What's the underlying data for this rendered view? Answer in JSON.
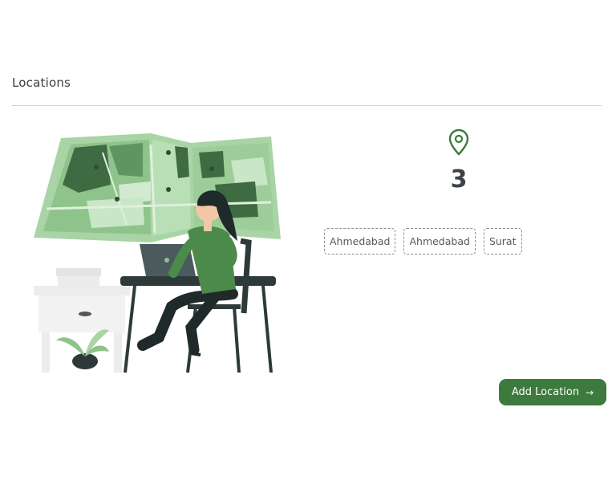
{
  "page": {
    "title": "Locations"
  },
  "stats": {
    "count": "3",
    "icon": "map-pin-icon",
    "accent": "#3c7a3d"
  },
  "locations": [
    "Ahmedabad",
    "Ahmedabad",
    "Surat"
  ],
  "actions": {
    "add_label": "Add Location",
    "add_icon": "→"
  },
  "colors": {
    "primary": "#3c7a3d",
    "text": "#3b3f44",
    "divider": "#cfd3d6"
  }
}
